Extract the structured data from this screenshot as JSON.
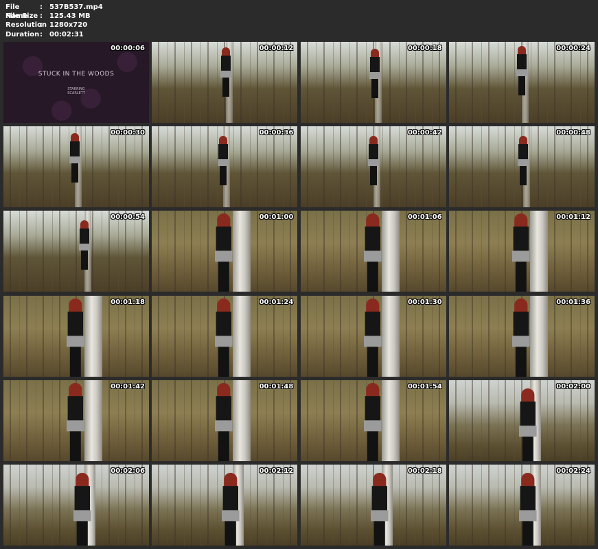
{
  "file_info": {
    "rows": [
      {
        "key": "File Name",
        "value": "537B537.mp4"
      },
      {
        "key": "File Size",
        "value": "125.43 MB"
      },
      {
        "key": "Resolution",
        "value": "1280x720"
      },
      {
        "key": "Duration",
        "value": "00:02:31"
      }
    ],
    "separator": ":"
  },
  "title_card": {
    "title": "STUCK IN THE WOODS",
    "starring_label": "STARRING",
    "starring_name": "SCARLETT"
  },
  "thumbnails": [
    {
      "time": "00:00:06",
      "kind": "title"
    },
    {
      "time": "00:00:12",
      "kind": "wide"
    },
    {
      "time": "00:00:18",
      "kind": "wide"
    },
    {
      "time": "00:00:24",
      "kind": "wide"
    },
    {
      "time": "00:00:30",
      "kind": "wide"
    },
    {
      "time": "00:00:36",
      "kind": "wide"
    },
    {
      "time": "00:00:42",
      "kind": "wide"
    },
    {
      "time": "00:00:48",
      "kind": "wide"
    },
    {
      "time": "00:00:54",
      "kind": "wide"
    },
    {
      "time": "00:01:00",
      "kind": "closeup"
    },
    {
      "time": "00:01:06",
      "kind": "closeup"
    },
    {
      "time": "00:01:12",
      "kind": "closeup"
    },
    {
      "time": "00:01:18",
      "kind": "closeup"
    },
    {
      "time": "00:01:24",
      "kind": "closeup"
    },
    {
      "time": "00:01:30",
      "kind": "closeup"
    },
    {
      "time": "00:01:36",
      "kind": "closeup"
    },
    {
      "time": "00:01:42",
      "kind": "closeup"
    },
    {
      "time": "00:01:48",
      "kind": "closeup"
    },
    {
      "time": "00:01:54",
      "kind": "closeup"
    },
    {
      "time": "00:02:00",
      "kind": "mid"
    },
    {
      "time": "00:02:06",
      "kind": "mid"
    },
    {
      "time": "00:02:12",
      "kind": "mid"
    },
    {
      "time": "00:02:18",
      "kind": "mid"
    },
    {
      "time": "00:02:24",
      "kind": "mid"
    }
  ],
  "colors": {
    "background": "#2b2b2b",
    "text": "#ffffff"
  }
}
